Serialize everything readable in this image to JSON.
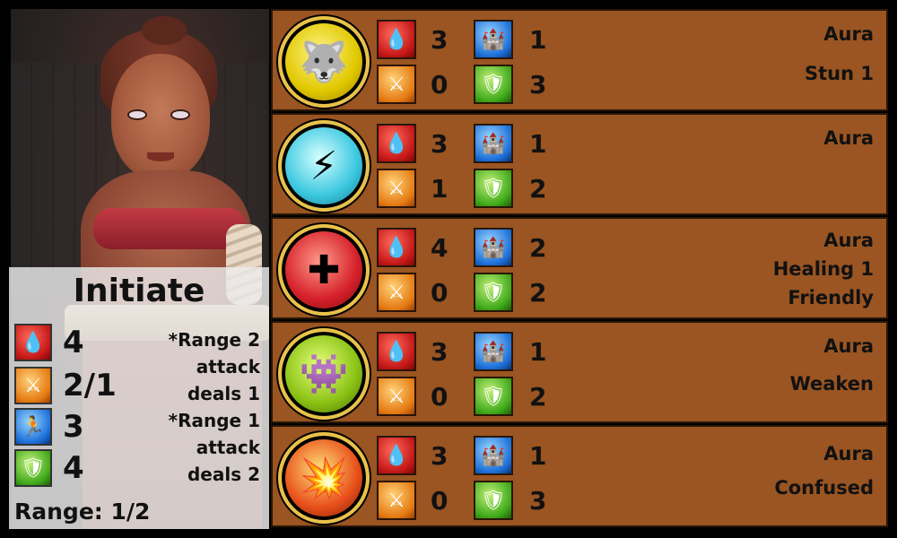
{
  "character": {
    "name": "Initiate",
    "stats": [
      {
        "icon": "health-icon",
        "color": "red",
        "value": "4"
      },
      {
        "icon": "attack-icon",
        "color": "orange",
        "value": "2/1"
      },
      {
        "icon": "movement-icon",
        "color": "blue",
        "value": "3"
      },
      {
        "icon": "defense-icon",
        "color": "green",
        "value": "4"
      }
    ],
    "notes": [
      "*Range 2",
      "attack",
      "deals 1",
      "*Range 1",
      "attack",
      "deals 2"
    ],
    "range": "Range: 1/2"
  },
  "units": [
    {
      "medallion_icon": "stun-beast-icon",
      "medallion_color": "yellow",
      "health": "3",
      "move": "1",
      "attack": "0",
      "defense": "3",
      "abilities": [
        "Aura",
        "Stun 1"
      ]
    },
    {
      "medallion_icon": "lightning-warrior-icon",
      "medallion_color": "cyan",
      "health": "3",
      "move": "1",
      "attack": "1",
      "defense": "2",
      "abilities": [
        "Aura"
      ]
    },
    {
      "medallion_icon": "healing-figure-icon",
      "medallion_color": "red",
      "health": "4",
      "move": "2",
      "attack": "0",
      "defense": "2",
      "abilities": [
        "Aura",
        "Healing 1",
        "Friendly"
      ]
    },
    {
      "medallion_icon": "weaken-troll-icon",
      "medallion_color": "lime",
      "health": "3",
      "move": "1",
      "attack": "0",
      "defense": "2",
      "abilities": [
        "Aura",
        "Weaken"
      ]
    },
    {
      "medallion_icon": "confused-fighters-icon",
      "medallion_color": "fire",
      "health": "3",
      "move": "1",
      "attack": "0",
      "defense": "3",
      "abilities": [
        "Aura",
        "Confused"
      ]
    }
  ],
  "colors": {
    "row_bg": "#9a5522",
    "medallion_ring": "#e8c24a",
    "stat_panel_bg": "#ebebeb"
  }
}
